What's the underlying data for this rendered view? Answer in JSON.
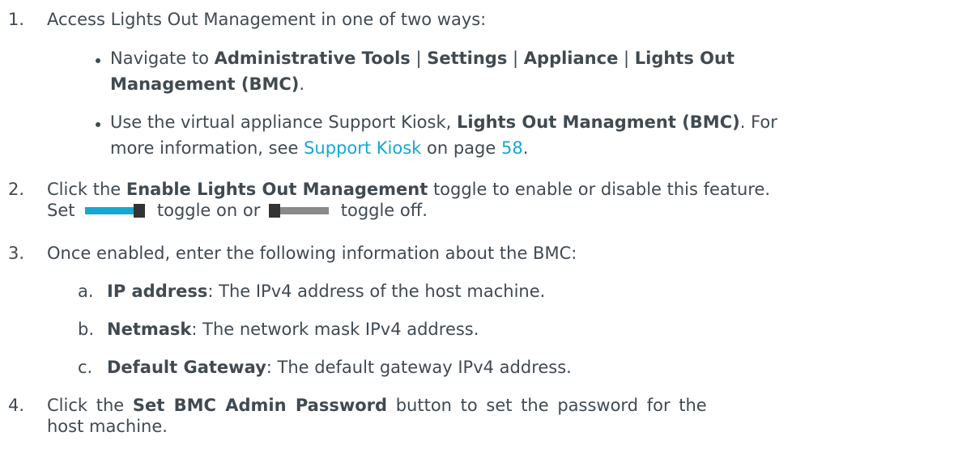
{
  "steps": {
    "s1": {
      "num": "1.",
      "text": "Access Lights Out Management in one of two ways:",
      "bullet1": {
        "p1": "Navigate to ",
        "b1": "Administrative Tools",
        "sep1": " | ",
        "b2": "Settings",
        "sep2": " | ",
        "b3": "Appliance",
        "sep3": " | ",
        "b4a": "Lights Out",
        "b4b": "Management (BMC)",
        "end": "."
      },
      "bullet2": {
        "p1": "Use the virtual appliance Support Kiosk, ",
        "b1": "Lights Out Managment (BMC)",
        "p2": ". For",
        "p3": "more information, see ",
        "link1": "Support Kiosk",
        "p4": " on page ",
        "link2": "58",
        "end": "."
      }
    },
    "s2": {
      "num": "2.",
      "p1": "Click the ",
      "b1": "Enable Lights Out Management",
      "p2": " toggle to enable or disable this feature.",
      "p3": "Set",
      "p4": "toggle on or",
      "p5": "toggle off."
    },
    "s3": {
      "num": "3.",
      "text": "Once enabled, enter the following information about the BMC:",
      "items": [
        {
          "letter": "a.",
          "label": "IP address",
          "desc": ": The IPv4 address of the host machine."
        },
        {
          "letter": "b.",
          "label": "Netmask",
          "desc": ": The network mask IPv4 address."
        },
        {
          "letter": "c.",
          "label": "Default Gateway",
          "desc": ": The default gateway IPv4 address."
        }
      ]
    },
    "s4": {
      "num": "4.",
      "p1": " Click the ",
      "b1": "Set BMC Admin Password",
      "p2": " button to set the password for the",
      "p3": "host machine."
    }
  },
  "colors": {
    "text": "#404a51",
    "link": "#16a7d4",
    "toggle_on": "#16a7d4",
    "toggle_off": "#8a8a8a",
    "toggle_knob": "#333333"
  }
}
